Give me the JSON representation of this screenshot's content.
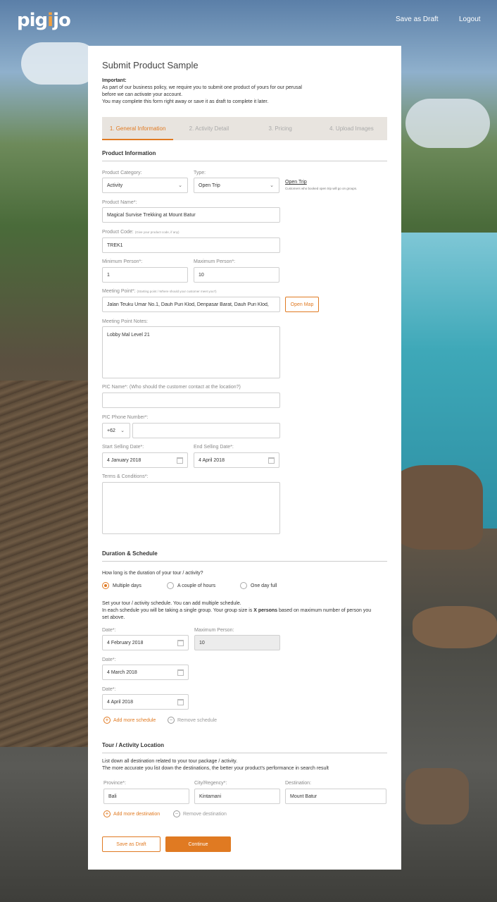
{
  "header": {
    "logo_text_1": "pig",
    "logo_text_2": "i",
    "logo_text_3": "jo",
    "save_draft": "Save as Draft",
    "logout": "Logout"
  },
  "form": {
    "title": "Submit Product Sample",
    "notice_heading": "Important:",
    "notice_line1": "As part of our business policy, we require you to submit one product of yours for our perusal",
    "notice_line2": "before we can activate your account.",
    "notice_line3": "You may complete this form right away or save it as draft to complete it later.",
    "steps": [
      "1. General Information",
      "2. Activity Detail",
      "3. Pricing",
      "4. Upload Images"
    ]
  },
  "product_info": {
    "section_title": "Product Information",
    "category_label": "Product Category:",
    "category_value": "Activity",
    "type_label": "Type:",
    "type_value": "Open Trip",
    "type_hint_title": "Open Trip",
    "type_hint_text": "Customers who booked open trip will go on groups.",
    "name_label": "Product Name*:",
    "name_value": "Magical Survise Trekking at Mount Batur",
    "code_label": "Product Code:",
    "code_hint": "(Give your product code, if any)",
    "code_value": "TREK1",
    "min_label": "Minimum Person*:",
    "min_value": "1",
    "max_label": "Maximum Person*:",
    "max_value": "10",
    "meeting_label": "Meeting Point*:",
    "meeting_hint": "(Starting point / Where should your customer meet you?)",
    "meeting_value": "Jalan Teuku Umar No.1, Dauh Puri Klod, Denpasar Barat, Dauh Puri Klod,",
    "open_map": "Open Map",
    "notes_label": "Meeting Point Notes:",
    "notes_value": "Lobby Mal Level 21",
    "pic_name_label": "PIC Name*: (Who should the customer contact at the location?)",
    "pic_phone_label": "PIC Phone Number*:",
    "phone_code": "+62",
    "start_label": "Start Selling Date*:",
    "start_value": "4 January 2018",
    "end_label": "End Selling Date*:",
    "end_value": "4 April 2018",
    "terms_label": "Terms & Conditions*:"
  },
  "duration": {
    "section_title": "Duration & Schedule",
    "question": "How long is the duration of your tour / activity?",
    "options": [
      "Multiple days",
      "A couple of hours",
      "One day full"
    ],
    "text1": "Set your tour / activity schedule. You can add multiple schedule.",
    "text2a": "In each schedule you will be taking  a single group. Your group size is ",
    "text2b": "X persons",
    "text2c": " based on maximum number of person you",
    "text3": "set above.",
    "date_label": "Date*:",
    "max_person_label": "Maximum Person:",
    "dates": [
      "4 February 2018",
      "4 March 2018",
      "4 April 2018"
    ],
    "max_person_value": "10",
    "add_schedule": "Add more schedule",
    "remove_schedule": "Remove schedule"
  },
  "location": {
    "section_title": "Tour / Activity Location",
    "text1": "List down all destination related to your tour package / activity.",
    "text2": "The more accurate you list down the destinations, the better your product's performance in search result",
    "province_label": "Province*:",
    "province_value": "Bali",
    "city_label": "City/Regency*:",
    "city_value": "Kintamani",
    "dest_label": "Destination:",
    "dest_value": "Mount Batur",
    "add_destination": "Add more destination",
    "remove_destination": "Remove destination"
  },
  "footer": {
    "save_draft": "Save as Draft",
    "continue": "Continue"
  },
  "colors": {
    "accent": "#e07a22"
  }
}
